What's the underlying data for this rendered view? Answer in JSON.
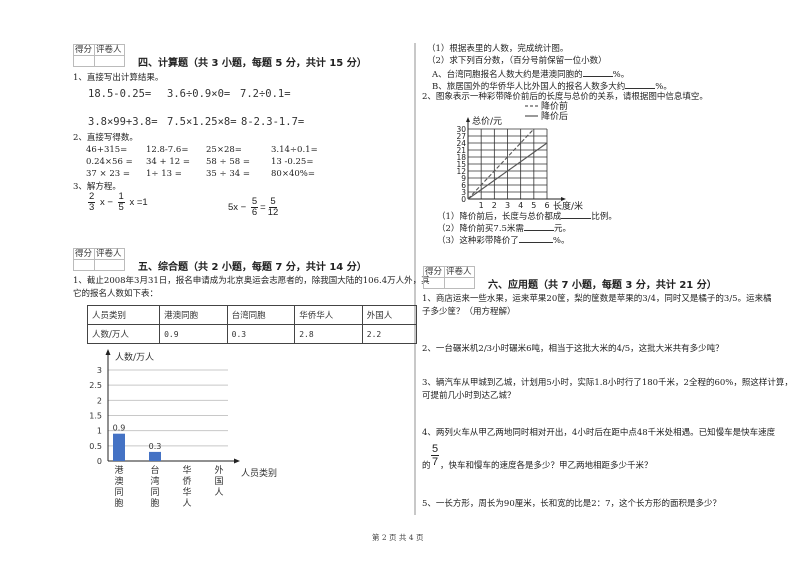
{
  "score_box": {
    "col1": "得分",
    "col2": "评卷人"
  },
  "section4": {
    "title": "四、计算题（共 3 小题，每题 5 分，共计 15 分）",
    "q1_label": "1、直接写出计算结果。",
    "q1_items": [
      "18.5-0.25=",
      "3.6÷0.9×0=",
      "7.2÷0.1=",
      "3.8×99+3.8=",
      "7.5×1.25×8=",
      "8-2.3-1.7="
    ],
    "q2_label": "2、直接写得数。",
    "q2_items": [
      [
        "46+315=",
        "12.8-7.6=",
        "25×28=",
        "3.14÷0.1="
      ],
      [
        "0.24×56 =",
        "34 + 12 =",
        "58 ÷ 58 =",
        "13 -0.25="
      ],
      [
        "37 × 23 =",
        "1÷ 13 =",
        "35 ÷ 34 =",
        "80×40%="
      ]
    ],
    "q3_label": "3、解方程。",
    "eq1": {
      "a_num": "2",
      "a_den": "3",
      "mid": "x −",
      "b_num": "1",
      "b_den": "5",
      "end": "x =1"
    },
    "eq2": {
      "start": "5x −",
      "a_num": "5",
      "a_den": "6",
      "eqsign": "=",
      "b_num": "5",
      "b_den": "12"
    }
  },
  "section5": {
    "title": "五、综合题（共 2 小题，每题 7 分，共计 14 分）",
    "q1_line1": "1、截止2008年3月31日，报名申请成为北京奥运会志愿者的，除我国大陆的106.4万人外，其",
    "q1_line2": "它的报名人数如下表：",
    "table": {
      "header": [
        "人员类别",
        "港澳同胞",
        "台湾同胞",
        "华侨华人",
        "外国人"
      ],
      "row": [
        "人数/万人",
        "0.9",
        "0.3",
        "2.8",
        "2.2"
      ]
    }
  },
  "right_top": {
    "sub1": "（1）根据表里的人数，完成统计图。",
    "sub2": "（2）求下列百分数，（百分号前保留一位小数）",
    "subA_pre": "A、台湾同胞报名人数大约是港澳同胞的",
    "subA_post": "%。",
    "subB_pre": "B、旅居国外的华侨华人比外国人的报名人数多大约",
    "subB_post": "%。",
    "q2": "2、图象表示一种彩带降价前后的长度与总价的关系，请根据图中信息填空。",
    "fill1_pre": "（1）降价前后，长度与总价都成",
    "fill1_post": "比例。",
    "fill2_pre": "（2）降价前买7.5米需",
    "fill2_post": "元。",
    "fill3_pre": "（3）这种彩带降价了",
    "fill3_post": "%。"
  },
  "section6": {
    "title": "六、应用题（共 7 小题，每题 3 分，共计 21 分）",
    "q1_line1": "1、商店运来一些水果，运来苹果20筐，梨的筐数是苹果的3/4，同时又是橘子的3/5。运来橘",
    "q1_line2": "子多少筐？（用方程解）",
    "q2": "2、一台碾米机2/3小时碾米6吨，相当于这批大米的4/5，这批大米共有多少吨？",
    "q3_line1": "3、辆汽车从甲城到乙城，计划用5小时，实际1.8小时行了180千米，2全程的60%，照这样计算，",
    "q3_line2": "可提前几小时到达乙城？",
    "q4_line1": "4、两列火车从甲乙两地同时相对开出，4小时后在距中点48千米处相遇。已知慢车是快车速度",
    "q4_frac_num": "5",
    "q4_frac_den": "7",
    "q4_pre": "的",
    "q4_line2": "，快车和慢车的速度各是多少？甲乙两地相距多少千米？",
    "q5": "5、一长方形，周长为90厘米，长和宽的比是2：7，这个长方形的面积是多少？"
  },
  "footer": {
    "page": "第 2 页 共 4 页"
  },
  "chart_data": [
    {
      "type": "bar",
      "title": "",
      "ylabel": "人数/万人",
      "xlabel": "人员类别",
      "categories": [
        "港澳同胞",
        "台湾同胞",
        "华侨华人",
        "外国人"
      ],
      "values": [
        0.9,
        0.3,
        null,
        null
      ],
      "data_labels": [
        "0.9",
        "0.3",
        "",
        ""
      ],
      "yticks": [
        "0",
        "0.5",
        "1",
        "1.5",
        "2",
        "2.5",
        "3"
      ],
      "ylim": [
        0,
        3
      ],
      "grid": true,
      "bar_color": "#4472c4"
    },
    {
      "type": "line",
      "ylabel": "总价/元",
      "xlabel": "长度/米",
      "xticks": [
        "0",
        "1",
        "2",
        "3",
        "4",
        "5",
        "6"
      ],
      "yticks": [
        "0",
        "3",
        "6",
        "9",
        "12",
        "15",
        "18",
        "21",
        "24",
        "27",
        "30"
      ],
      "xlim": [
        0,
        6
      ],
      "ylim": [
        0,
        30
      ],
      "grid": true,
      "series": [
        {
          "name": "降价前",
          "style": "dashed",
          "x": [
            0,
            5
          ],
          "y": [
            0,
            30
          ]
        },
        {
          "name": "降价后",
          "style": "solid",
          "x": [
            0,
            6
          ],
          "y": [
            0,
            24
          ]
        }
      ],
      "legend": "top-right"
    }
  ]
}
